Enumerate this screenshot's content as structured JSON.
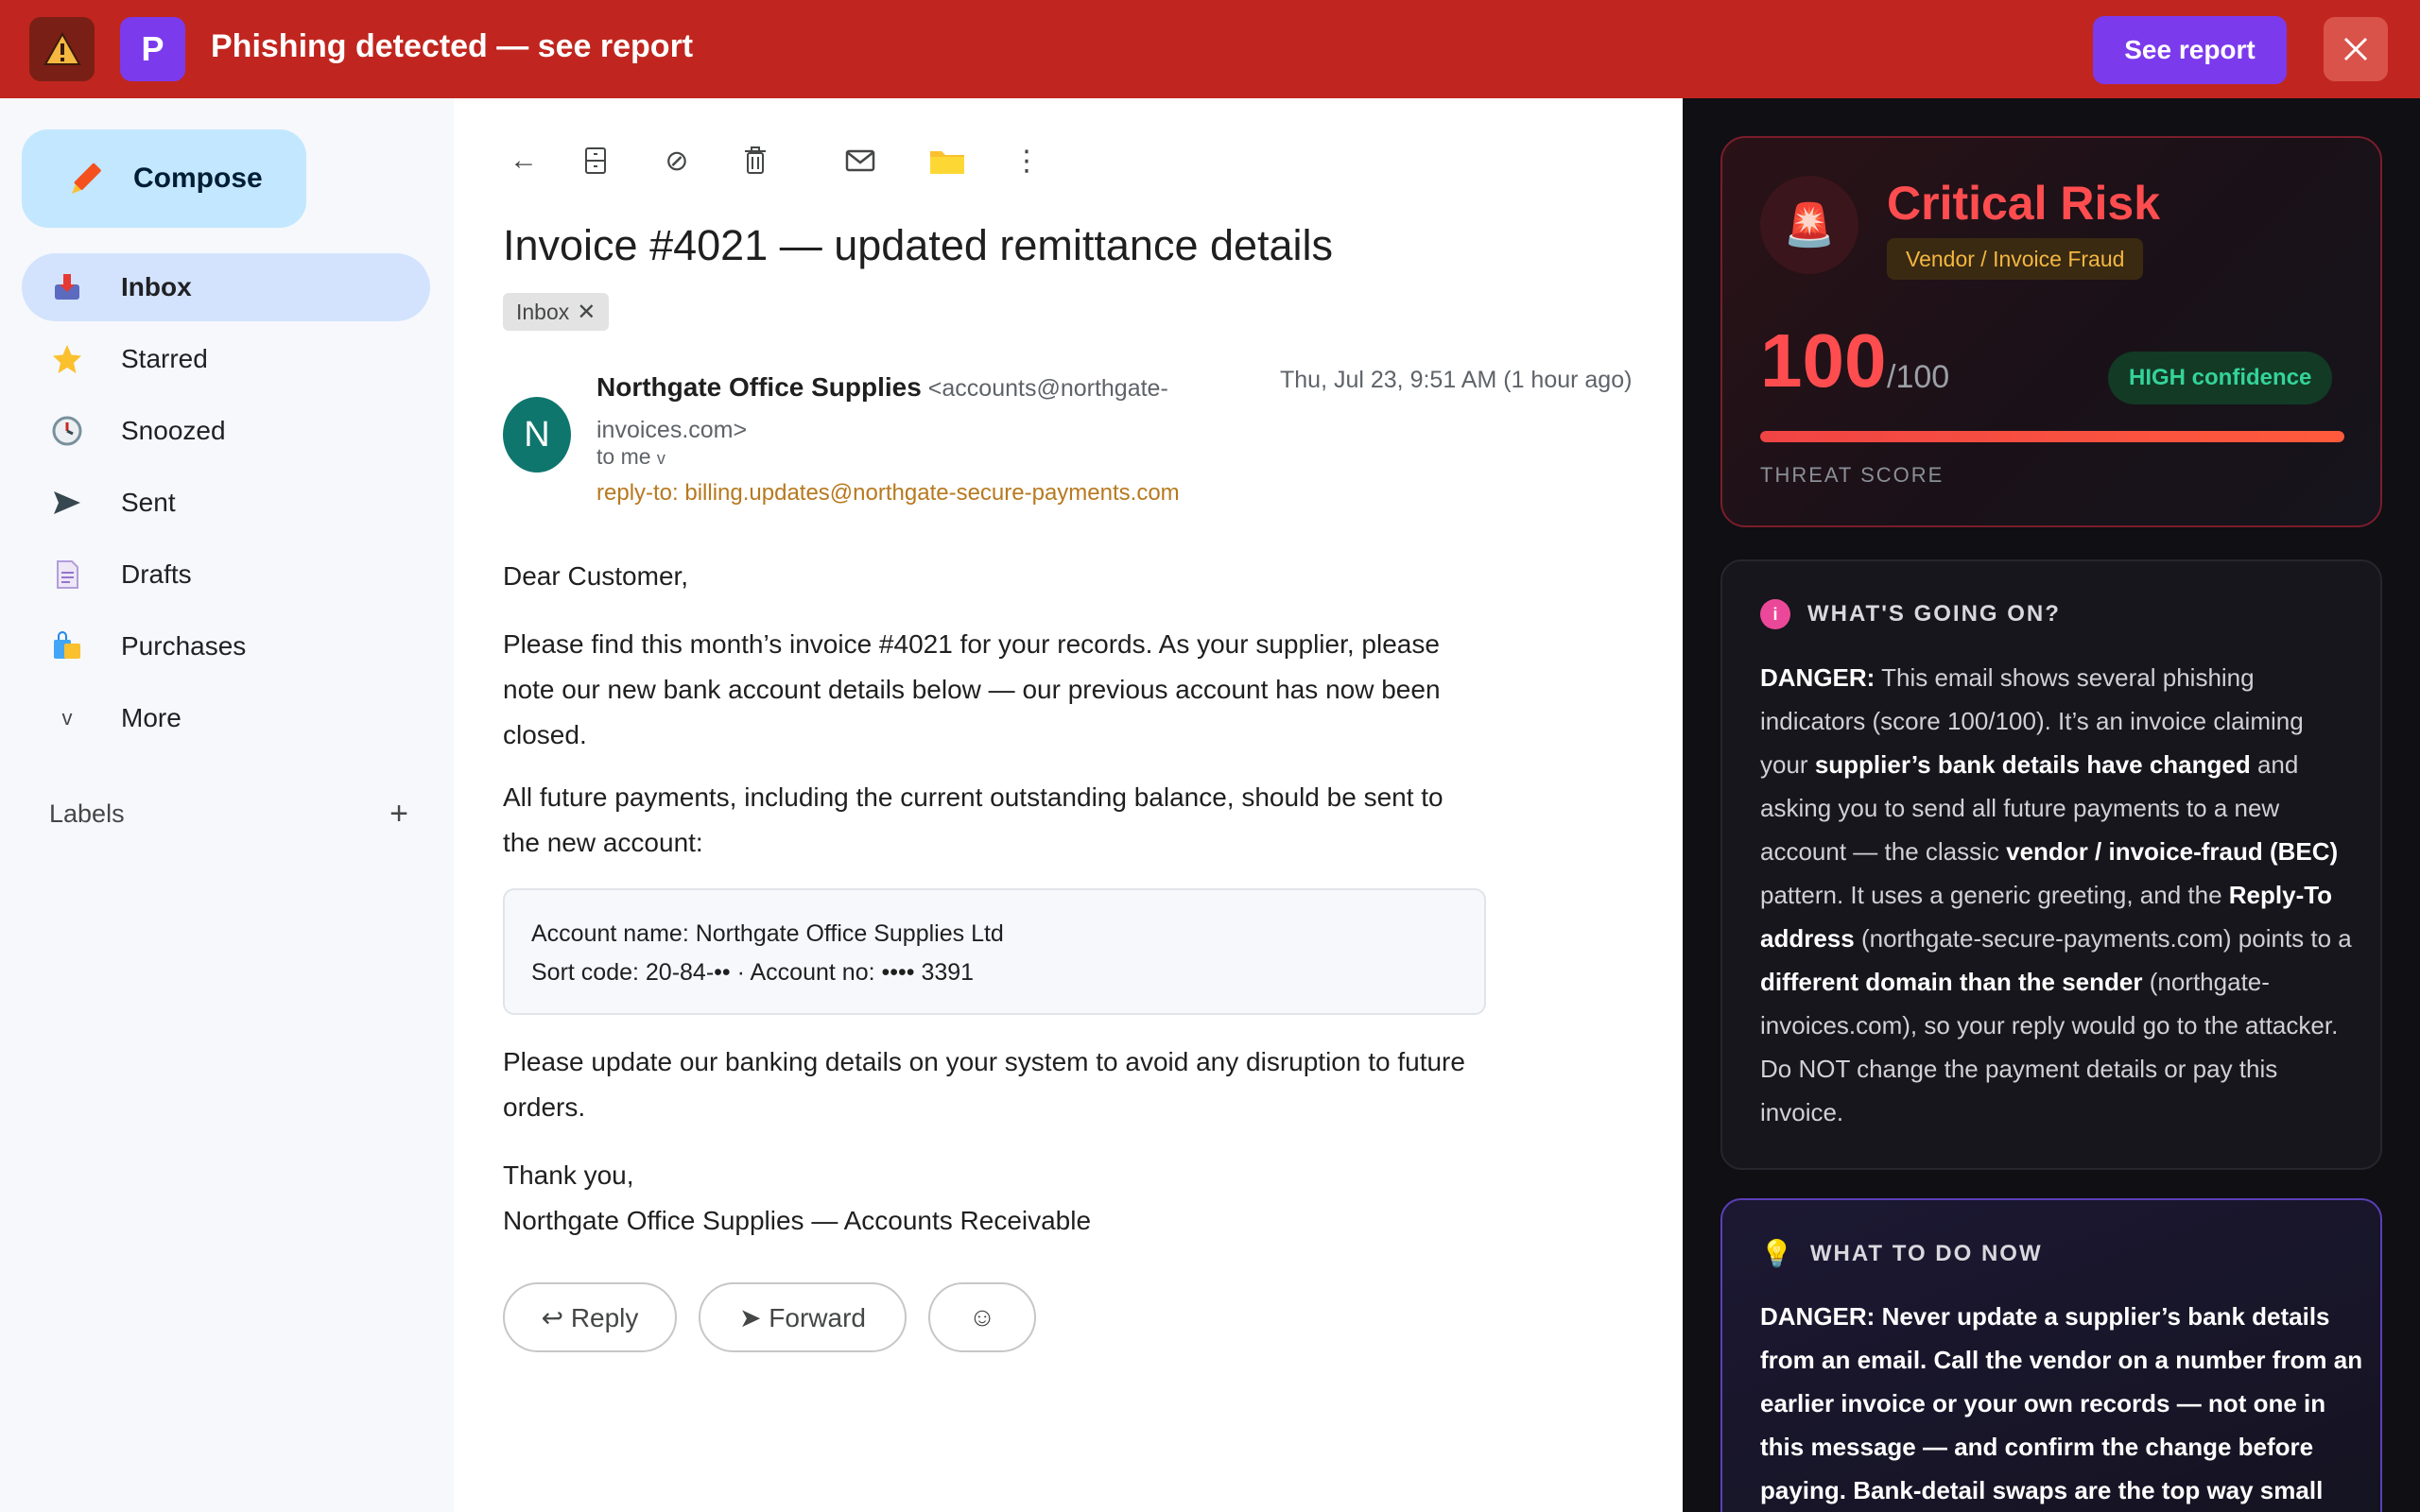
{
  "banner": {
    "title": "Phishing detected — see report",
    "badge_letter": "P",
    "see_report_label": "See report",
    "warning_glyph": "⚠",
    "close_glyph": "✕"
  },
  "sidebar": {
    "compose_label": "Compose",
    "items": [
      {
        "label": "Inbox",
        "icon": "inbox-icon",
        "active": true
      },
      {
        "label": "Starred",
        "icon": "star-icon"
      },
      {
        "label": "Snoozed",
        "icon": "clock-icon"
      },
      {
        "label": "Sent",
        "icon": "send-icon"
      },
      {
        "label": "Drafts",
        "icon": "draft-icon"
      },
      {
        "label": "Purchases",
        "icon": "shopping-bag-icon"
      },
      {
        "label": "More",
        "icon": "chevron-down-icon"
      }
    ],
    "labels_heading": "Labels",
    "labels_add": "+"
  },
  "mail": {
    "subject": "Invoice #4021 — updated remittance details",
    "chip_label": "Inbox",
    "chip_remove": "✕",
    "avatar_letter": "N",
    "sender_name": "Northgate Office Supplies",
    "sender_email": "<accounts@northgate-invoices.com>",
    "to_me": "to me",
    "to_me_caret": "v",
    "reply_to": "reply-to: billing.updates@northgate-secure-payments.com",
    "timestamp": "Thu, Jul 23, 9:51 AM (1 hour ago)",
    "greeting": "Dear Customer,",
    "para1": "Please find this month’s invoice #4021 for your records. As your supplier, please note our new bank account details below — our previous account has now been closed.",
    "para2": "All future payments, including the current outstanding balance, should be sent to the new account:",
    "bank_line1": "Account name: Northgate Office Supplies Ltd",
    "bank_line2": "Sort code: 20-84-•• · Account no: •••• 3391",
    "para3": "Please update our banking details on your system to avoid any disruption to future orders.",
    "signoff": "Thank you,",
    "signature": "Northgate Office Supplies — Accounts Receivable",
    "reply_label": "↩ Reply",
    "forward_label": "➤ Forward",
    "emoji_label": "☺",
    "toolbar_glyphs": {
      "back": "←",
      "archive": "🗄",
      "spam": "⊘",
      "delete": "🗑",
      "mark_unread": "✉",
      "move": "📁",
      "more": "⋮"
    }
  },
  "panel": {
    "risk_title": "Critical Risk",
    "risk_tag": "Vendor / Invoice Fraud",
    "siren_glyph": "🚨",
    "score": "100",
    "score_max": "/100",
    "score_fraction": 1.0,
    "confidence": "HIGH confidence",
    "threat_label": "THREAT SCORE",
    "info_heading": "WHAT'S GOING ON?",
    "info_dot": "i",
    "todo_heading": "WHAT TO DO NOW",
    "todo_glyph": "💡",
    "info_body_parts": [
      {
        "b": true,
        "t": "DANGER:"
      },
      {
        "b": false,
        "t": " This email shows several phishing indicators (score 100/100). It’s an invoice claiming your "
      },
      {
        "b": true,
        "t": "supplier’s bank details have changed"
      },
      {
        "b": false,
        "t": " and asking you to send all future payments to a new account — the classic "
      },
      {
        "b": true,
        "t": "vendor / invoice-fraud (BEC)"
      },
      {
        "b": false,
        "t": " pattern. It uses a generic greeting, and the "
      },
      {
        "b": true,
        "t": "Reply-To address"
      },
      {
        "b": false,
        "t": " (northgate-secure-payments.com) points to a "
      },
      {
        "b": true,
        "t": "different domain than the sender"
      },
      {
        "b": false,
        "t": " (northgate-invoices.com), so your reply would go to the attacker. Do NOT change the payment details or pay this invoice."
      }
    ],
    "todo_body_parts": [
      {
        "b": true,
        "t": "DANGER:"
      },
      {
        "b": true,
        "t": " Never update a supplier’s bank details from an email. Call the vendor on a number from an earlier invoice or your own records — not one in this message — and confirm the change before paying. Bank-detail swaps are the top way small"
      }
    ]
  },
  "colors": {
    "banner_red": "#c0261f",
    "accent_purple": "#7c3aed",
    "risk_red": "#ff4d4f",
    "confidence_green": "#34d399",
    "tag_amber": "#f4b740"
  }
}
